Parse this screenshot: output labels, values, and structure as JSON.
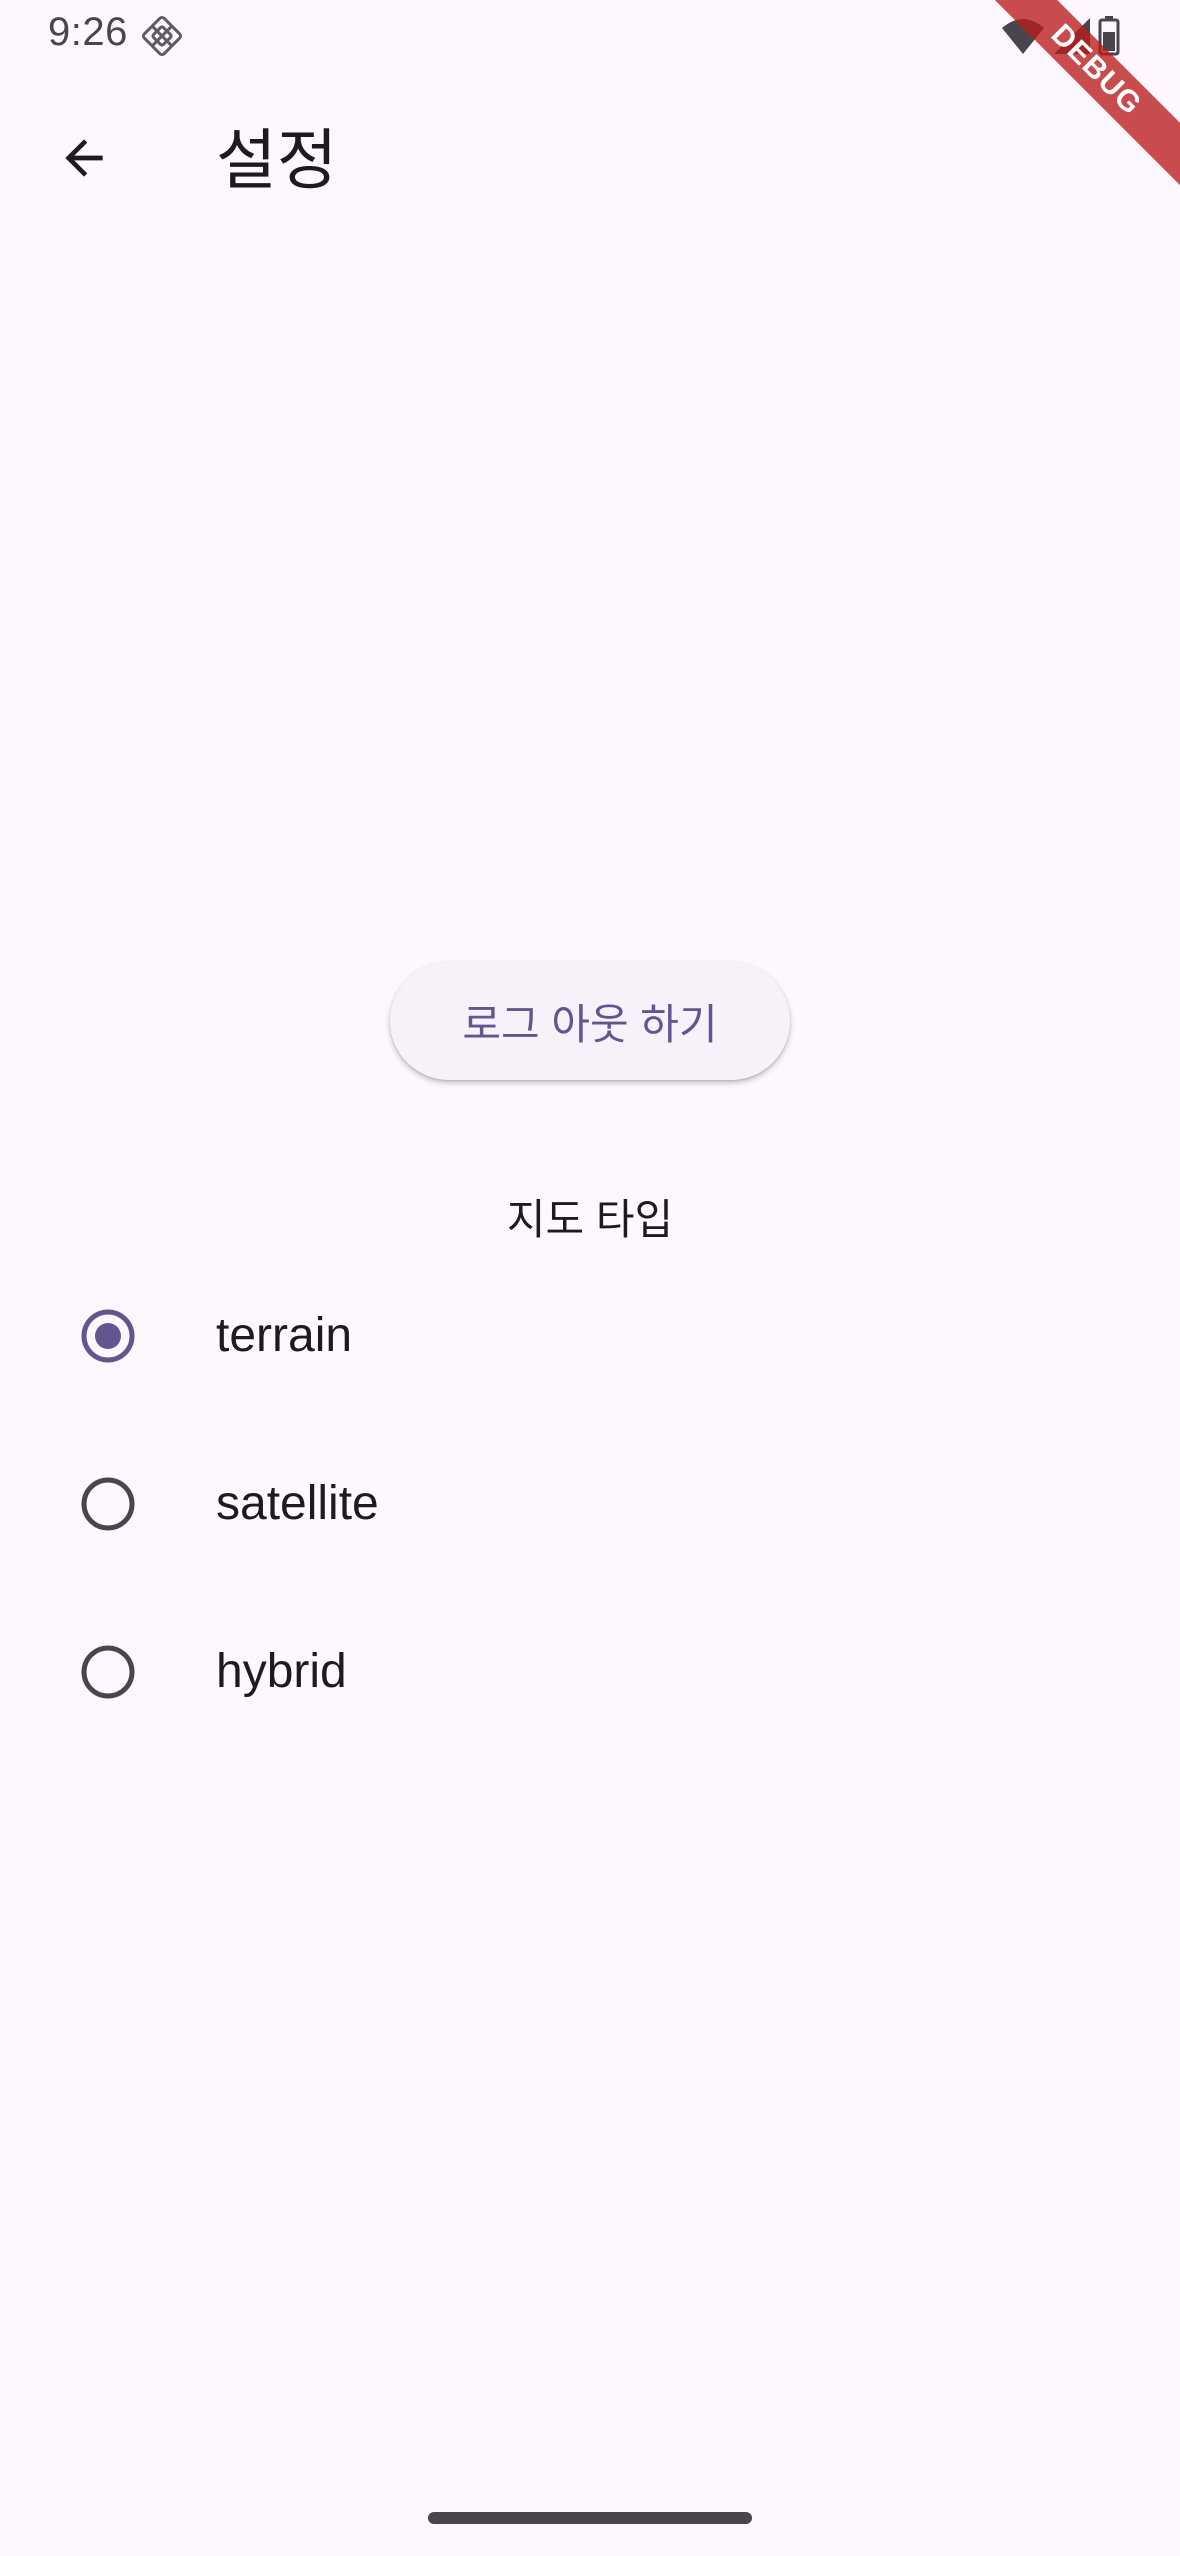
{
  "status_bar": {
    "time": "9:26",
    "notification_icon": "app-notification-icon",
    "wifi_icon": "wifi-icon",
    "signal_icon": "cellular-signal-icon",
    "battery_icon": "battery-icon"
  },
  "debug_banner": {
    "label": "DEBUG"
  },
  "app_bar": {
    "back_icon": "arrow-back-icon",
    "title": "설정"
  },
  "logout": {
    "label": "로그 아웃 하기"
  },
  "map_type": {
    "title": "지도 타입",
    "selected": "terrain",
    "options": [
      {
        "label": "terrain",
        "selected": true
      },
      {
        "label": "satellite",
        "selected": false
      },
      {
        "label": "hybrid",
        "selected": false
      }
    ]
  },
  "colors": {
    "background": "#fef7ff",
    "primary": "#65558f",
    "on_surface": "#1d1b20",
    "outline": "#49454f",
    "button_surface": "#f7f2fa",
    "debug_banner": "#b91c1c"
  }
}
